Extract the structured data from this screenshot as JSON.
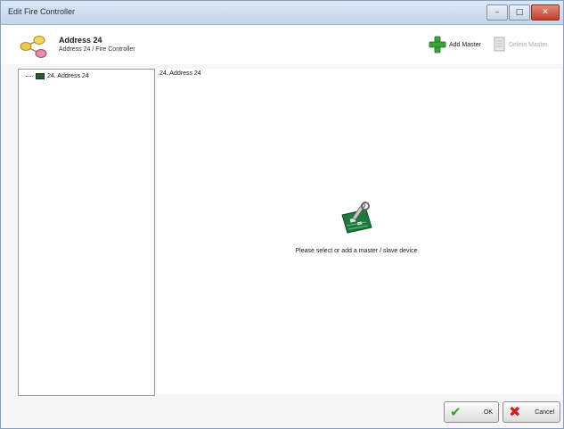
{
  "window": {
    "title": "Edit Fire Controller",
    "controls": {
      "minimize": "–",
      "maximize": "□",
      "close": "✕"
    }
  },
  "header": {
    "icon": "network-nodes-icon",
    "title": "Address 24",
    "subtitle": "Address 24 / Fire Controller"
  },
  "toolbar": {
    "add_label": "Add Master",
    "add_icon": "green-plus-icon",
    "delete_label": "Delete Master",
    "delete_icon": "delete-document-icon",
    "delete_enabled": false
  },
  "tree": {
    "items": [
      {
        "label": "24. Address 24",
        "icon": "controller-node-icon"
      }
    ]
  },
  "main": {
    "label": "24. Address 24",
    "icon": "circuit-board-wrench-icon",
    "message": "Please select or add a master / slave device"
  },
  "buttons": {
    "ok_label": "OK",
    "ok_icon": "checkmark-icon",
    "cancel_label": "Cancel",
    "cancel_icon": "red-x-icon"
  },
  "colors": {
    "title_bar": "#c4d6ea",
    "close_button": "#c2402c",
    "add_icon": "#3aa33a",
    "node_icon": "#1f5f2f",
    "ok_check": "#3c9a2c",
    "cancel_x": "#d21f1f"
  }
}
